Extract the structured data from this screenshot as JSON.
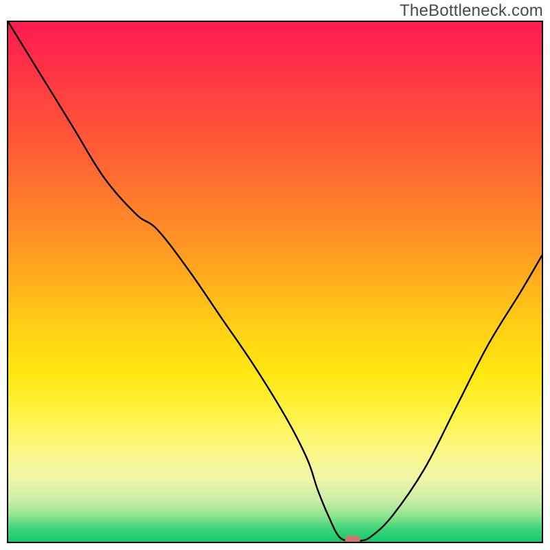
{
  "watermark": "TheBottleneck.com",
  "chart_data": {
    "type": "line",
    "title": "",
    "xlabel": "",
    "ylabel": "",
    "xlim": [
      0,
      100
    ],
    "ylim": [
      0,
      100
    ],
    "grid": false,
    "legend": false,
    "curve_comment": "Black curve: high at left, descends, flattens near bottom around x≈62, then rises to the right. Values are percentages in plot-area coordinates (0=left/bottom, 100=right/top).",
    "x": [
      0,
      6,
      12,
      18,
      24,
      28,
      34,
      40,
      46,
      52,
      56,
      58,
      60,
      62,
      64,
      66,
      68,
      72,
      78,
      84,
      90,
      96,
      100
    ],
    "y": [
      100,
      90,
      80,
      70,
      63,
      60,
      52,
      43,
      34,
      24,
      16,
      10,
      5,
      1,
      0.2,
      0.2,
      1,
      5,
      14,
      26,
      38,
      48,
      55
    ],
    "marker": {
      "x": 64.5,
      "y": 0.4,
      "label": "optimal-point"
    },
    "gradient_stops": [
      {
        "pos": 0,
        "color": "#ff1a52"
      },
      {
        "pos": 14,
        "color": "#ff4040"
      },
      {
        "pos": 34,
        "color": "#ff7a2c"
      },
      {
        "pos": 52,
        "color": "#ffb81a"
      },
      {
        "pos": 68,
        "color": "#ffe812"
      },
      {
        "pos": 83,
        "color": "#faf78a"
      },
      {
        "pos": 92,
        "color": "#c9eea6"
      },
      {
        "pos": 100,
        "color": "#12c96e"
      }
    ]
  }
}
